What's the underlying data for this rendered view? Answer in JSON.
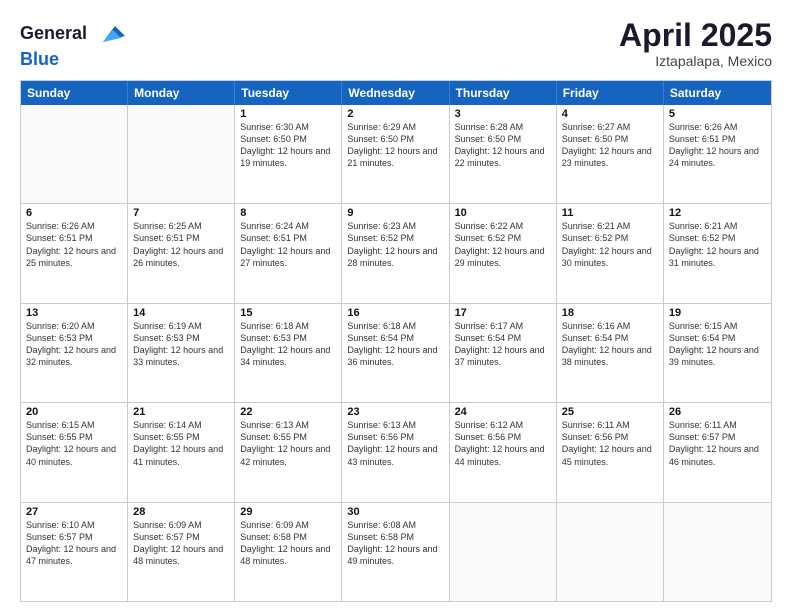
{
  "header": {
    "logo_general": "General",
    "logo_blue": "Blue",
    "month_title": "April 2025",
    "location": "Iztapalapa, Mexico"
  },
  "days_of_week": [
    "Sunday",
    "Monday",
    "Tuesday",
    "Wednesday",
    "Thursday",
    "Friday",
    "Saturday"
  ],
  "weeks": [
    [
      {
        "day": "",
        "empty": true
      },
      {
        "day": "",
        "empty": true
      },
      {
        "day": "1",
        "sunrise": "6:30 AM",
        "sunset": "6:50 PM",
        "daylight": "12 hours and 19 minutes."
      },
      {
        "day": "2",
        "sunrise": "6:29 AM",
        "sunset": "6:50 PM",
        "daylight": "12 hours and 21 minutes."
      },
      {
        "day": "3",
        "sunrise": "6:28 AM",
        "sunset": "6:50 PM",
        "daylight": "12 hours and 22 minutes."
      },
      {
        "day": "4",
        "sunrise": "6:27 AM",
        "sunset": "6:50 PM",
        "daylight": "12 hours and 23 minutes."
      },
      {
        "day": "5",
        "sunrise": "6:26 AM",
        "sunset": "6:51 PM",
        "daylight": "12 hours and 24 minutes."
      }
    ],
    [
      {
        "day": "6",
        "sunrise": "6:26 AM",
        "sunset": "6:51 PM",
        "daylight": "12 hours and 25 minutes."
      },
      {
        "day": "7",
        "sunrise": "6:25 AM",
        "sunset": "6:51 PM",
        "daylight": "12 hours and 26 minutes."
      },
      {
        "day": "8",
        "sunrise": "6:24 AM",
        "sunset": "6:51 PM",
        "daylight": "12 hours and 27 minutes."
      },
      {
        "day": "9",
        "sunrise": "6:23 AM",
        "sunset": "6:52 PM",
        "daylight": "12 hours and 28 minutes."
      },
      {
        "day": "10",
        "sunrise": "6:22 AM",
        "sunset": "6:52 PM",
        "daylight": "12 hours and 29 minutes."
      },
      {
        "day": "11",
        "sunrise": "6:21 AM",
        "sunset": "6:52 PM",
        "daylight": "12 hours and 30 minutes."
      },
      {
        "day": "12",
        "sunrise": "6:21 AM",
        "sunset": "6:52 PM",
        "daylight": "12 hours and 31 minutes."
      }
    ],
    [
      {
        "day": "13",
        "sunrise": "6:20 AM",
        "sunset": "6:53 PM",
        "daylight": "12 hours and 32 minutes."
      },
      {
        "day": "14",
        "sunrise": "6:19 AM",
        "sunset": "6:53 PM",
        "daylight": "12 hours and 33 minutes."
      },
      {
        "day": "15",
        "sunrise": "6:18 AM",
        "sunset": "6:53 PM",
        "daylight": "12 hours and 34 minutes."
      },
      {
        "day": "16",
        "sunrise": "6:18 AM",
        "sunset": "6:54 PM",
        "daylight": "12 hours and 36 minutes."
      },
      {
        "day": "17",
        "sunrise": "6:17 AM",
        "sunset": "6:54 PM",
        "daylight": "12 hours and 37 minutes."
      },
      {
        "day": "18",
        "sunrise": "6:16 AM",
        "sunset": "6:54 PM",
        "daylight": "12 hours and 38 minutes."
      },
      {
        "day": "19",
        "sunrise": "6:15 AM",
        "sunset": "6:54 PM",
        "daylight": "12 hours and 39 minutes."
      }
    ],
    [
      {
        "day": "20",
        "sunrise": "6:15 AM",
        "sunset": "6:55 PM",
        "daylight": "12 hours and 40 minutes."
      },
      {
        "day": "21",
        "sunrise": "6:14 AM",
        "sunset": "6:55 PM",
        "daylight": "12 hours and 41 minutes."
      },
      {
        "day": "22",
        "sunrise": "6:13 AM",
        "sunset": "6:55 PM",
        "daylight": "12 hours and 42 minutes."
      },
      {
        "day": "23",
        "sunrise": "6:13 AM",
        "sunset": "6:56 PM",
        "daylight": "12 hours and 43 minutes."
      },
      {
        "day": "24",
        "sunrise": "6:12 AM",
        "sunset": "6:56 PM",
        "daylight": "12 hours and 44 minutes."
      },
      {
        "day": "25",
        "sunrise": "6:11 AM",
        "sunset": "6:56 PM",
        "daylight": "12 hours and 45 minutes."
      },
      {
        "day": "26",
        "sunrise": "6:11 AM",
        "sunset": "6:57 PM",
        "daylight": "12 hours and 46 minutes."
      }
    ],
    [
      {
        "day": "27",
        "sunrise": "6:10 AM",
        "sunset": "6:57 PM",
        "daylight": "12 hours and 47 minutes."
      },
      {
        "day": "28",
        "sunrise": "6:09 AM",
        "sunset": "6:57 PM",
        "daylight": "12 hours and 48 minutes."
      },
      {
        "day": "29",
        "sunrise": "6:09 AM",
        "sunset": "6:58 PM",
        "daylight": "12 hours and 48 minutes."
      },
      {
        "day": "30",
        "sunrise": "6:08 AM",
        "sunset": "6:58 PM",
        "daylight": "12 hours and 49 minutes."
      },
      {
        "day": "",
        "empty": true
      },
      {
        "day": "",
        "empty": true
      },
      {
        "day": "",
        "empty": true
      }
    ]
  ]
}
